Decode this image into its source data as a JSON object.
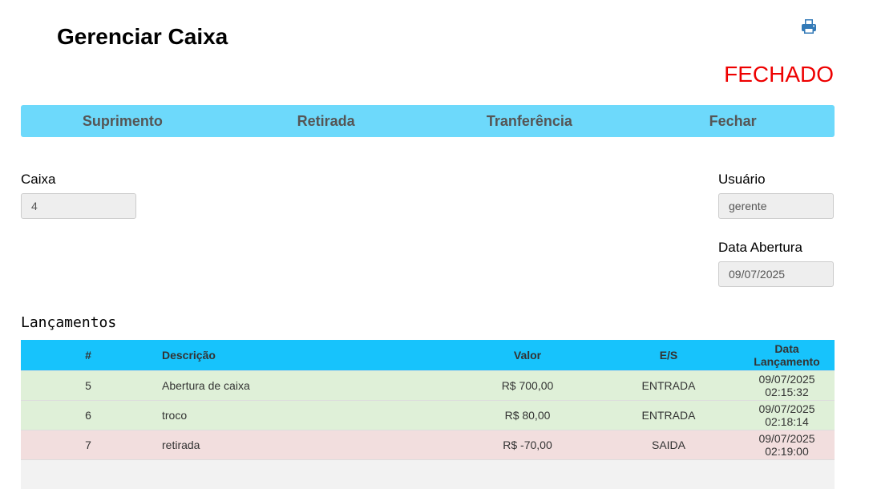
{
  "header": {
    "title": "Gerenciar Caixa",
    "status": "FECHADO",
    "status_color": "#ee0000",
    "print_icon": "print-icon"
  },
  "actions": [
    {
      "label": "Suprimento"
    },
    {
      "label": "Retirada"
    },
    {
      "label": "Tranferência"
    },
    {
      "label": "Fechar"
    }
  ],
  "form": {
    "caixa": {
      "label": "Caixa",
      "value": "4"
    },
    "usuario": {
      "label": "Usuário",
      "value": "gerente"
    },
    "data_abertura": {
      "label": "Data Abertura",
      "value": "09/07/2025"
    }
  },
  "launches": {
    "title": "Lançamentos",
    "columns": [
      "#",
      "Descrição",
      "Valor",
      "E/S",
      "Data Lançamento"
    ],
    "rows": [
      {
        "id": "5",
        "descricao": "Abertura de caixa",
        "valor": "R$ 700,00",
        "es": "ENTRADA",
        "data": "09/07/2025 02:15:32"
      },
      {
        "id": "6",
        "descricao": "troco",
        "valor": "R$ 80,00",
        "es": "ENTRADA",
        "data": "09/07/2025 02:18:14"
      },
      {
        "id": "7",
        "descricao": "retirada",
        "valor": "R$ -70,00",
        "es": "SAIDA",
        "data": "09/07/2025 02:19:00"
      }
    ]
  },
  "colors": {
    "action_bar": "#6dd9fb",
    "table_header": "#17c3fc",
    "entrada_row": "#dff0d8",
    "saida_row": "#f2dede"
  }
}
